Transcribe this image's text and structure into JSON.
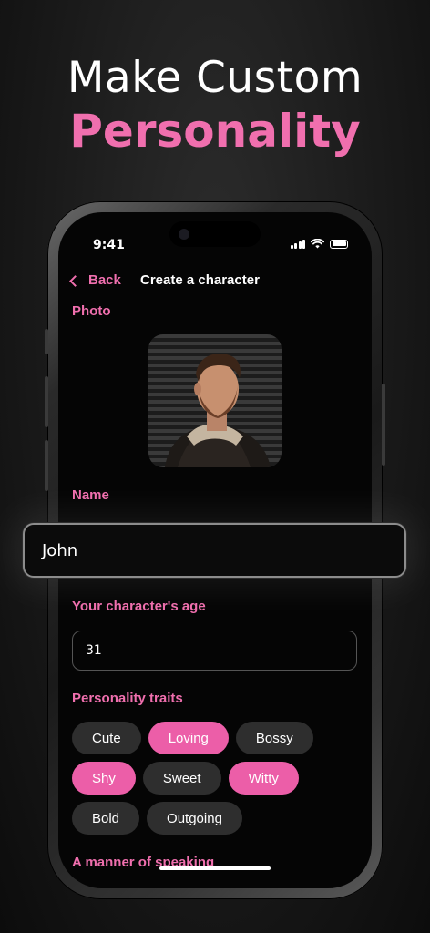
{
  "promo": {
    "headline_line1": "Make Custom",
    "headline_line2": "Personality"
  },
  "status_bar": {
    "time": "9:41"
  },
  "nav": {
    "back_label": "Back",
    "title": "Create a character"
  },
  "form": {
    "photo_label": "Photo",
    "name_label": "Name",
    "name_value": "John",
    "age_label": "Your character's age",
    "age_value": "31",
    "traits_label": "Personality traits",
    "traits": [
      {
        "label": "Cute",
        "selected": false
      },
      {
        "label": "Loving",
        "selected": true
      },
      {
        "label": "Bossy",
        "selected": false
      },
      {
        "label": "Shy",
        "selected": true
      },
      {
        "label": "Sweet",
        "selected": false
      },
      {
        "label": "Witty",
        "selected": true
      },
      {
        "label": "Bold",
        "selected": false
      },
      {
        "label": "Outgoing",
        "selected": false
      }
    ],
    "speaking_label": "A manner of speaking"
  },
  "colors": {
    "accent": "#f06fae",
    "chip_selected": "#ec5ea8",
    "chip_default": "#2e2e2e"
  }
}
